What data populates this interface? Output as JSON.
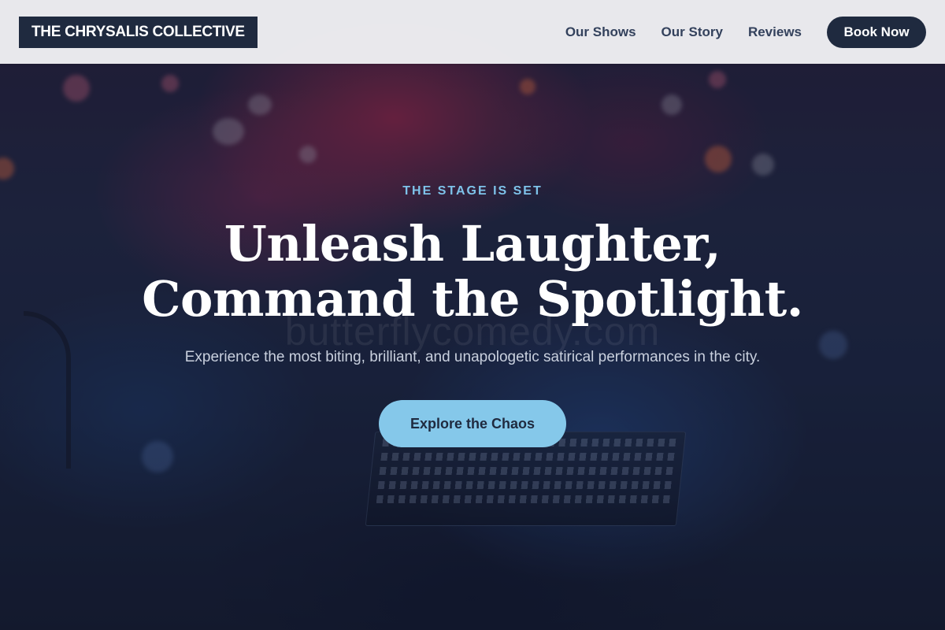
{
  "header": {
    "logo": "THE CHRYSALIS COLLECTIVE",
    "nav": [
      {
        "label": "Our Shows"
      },
      {
        "label": "Our Story"
      },
      {
        "label": "Reviews"
      }
    ],
    "cta_label": "Book Now"
  },
  "hero": {
    "eyebrow": "THE STAGE IS SET",
    "headline_line1": "Unleash Laughter,",
    "headline_line2": "Command the Spotlight.",
    "watermark": "butterflycomedy.com",
    "subtitle": "Experience the most biting, brilliant, and unapologetic satirical performances in the city.",
    "cta_label": "Explore the Chaos"
  },
  "colors": {
    "header_bg": "#f0f0f4",
    "logo_bg": "#1f2a3f",
    "accent": "#85c8ea",
    "eyebrow": "#7ec3ea",
    "nav_text": "#33415c"
  }
}
